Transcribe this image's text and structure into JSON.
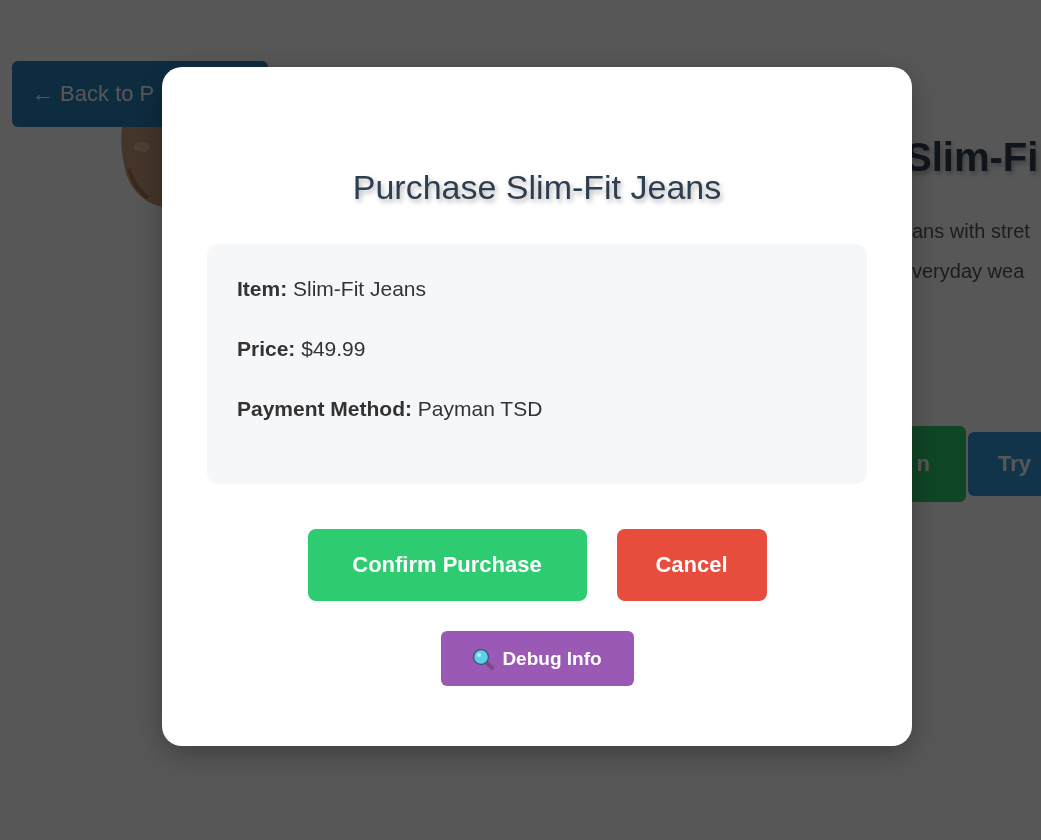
{
  "page": {
    "back_button": "← Back to P",
    "product_title": "Slim-Fi",
    "description_lines": [
      "ans with stret",
      "veryday wea"
    ],
    "buttons": [
      {
        "label": "n",
        "kind": "primary"
      },
      {
        "label": "Try",
        "kind": "secondary"
      }
    ]
  },
  "modal": {
    "title": "Purchase Slim-Fit Jeans",
    "details": [
      "**Item:** Slim-Fit Jeans",
      "**Price:** $49.99",
      "**Payment Method:** Payman TSD"
    ],
    "actions": [
      {
        "label": "Confirm Purchase",
        "kind": "confirm"
      },
      {
        "label": "Cancel",
        "kind": "cancel"
      }
    ],
    "debug_button": "Debug Info"
  }
}
